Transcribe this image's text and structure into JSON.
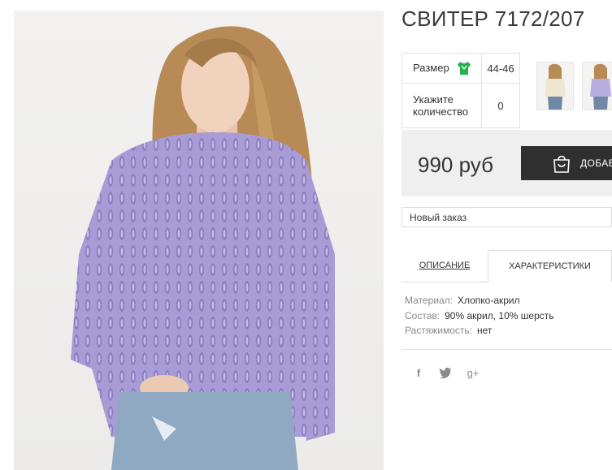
{
  "product": {
    "title": "СВИТЕР 7172/207"
  },
  "options": {
    "size_label": "Размер",
    "size_value": "44-46",
    "qty_label": "Укажите количество",
    "qty_value": "0"
  },
  "price": {
    "text": "990 руб",
    "cart_button": "ДОБАВ"
  },
  "order_select": {
    "value": "Новый заказ"
  },
  "tabs": [
    {
      "label": "ОПИСАНИЕ"
    },
    {
      "label": "ХАРАКТЕРИСТИКИ"
    }
  ],
  "specs": [
    {
      "key": "Материал:",
      "value": "Хлопко-акрил"
    },
    {
      "key": "Состав:",
      "value": "90% акрил, 10% шерсть"
    },
    {
      "key": "Растяжимость:",
      "value": "нет"
    }
  ],
  "social": [
    {
      "icon": "facebook-icon",
      "glyph": "f"
    },
    {
      "icon": "twitter-icon",
      "glyph": "🐦"
    },
    {
      "icon": "google-plus-icon",
      "glyph": "g+"
    }
  ],
  "colors": {
    "sweater": "#a99bd6",
    "accent_dark": "#2f2f2f",
    "size_icon": "#1fb24a"
  }
}
